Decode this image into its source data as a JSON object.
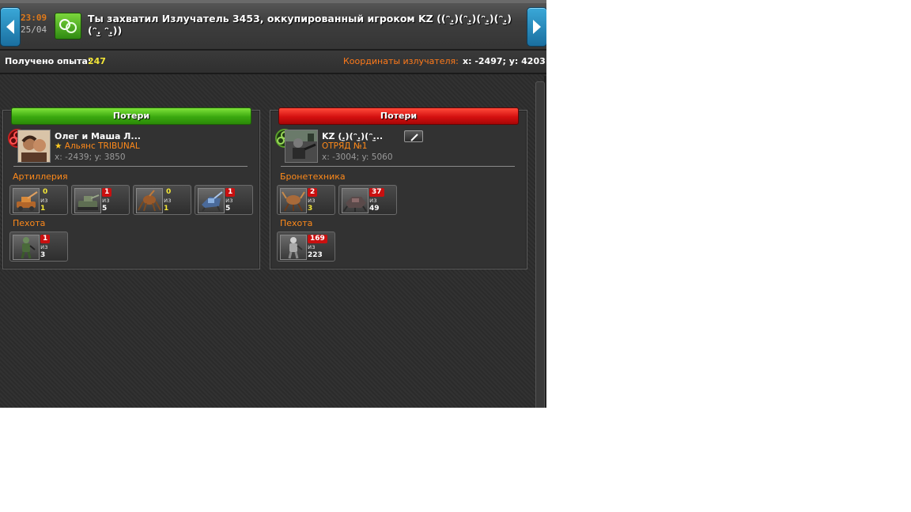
{
  "header": {
    "time": "23:09",
    "date": "25/04",
    "title": "Ты захватил Излучатель 3453, оккупированный игроком KZ ((ᵔ.̫)(ᵔ.̫)(ᵔ.̫)(ᵔ.̫)(ᵔ.̫ ᵔ.̫))",
    "icons": [
      "arrow-left-icon",
      "arrow-right-icon",
      "emitter-icon"
    ]
  },
  "info": {
    "xp_label": "Получено опыта:",
    "xp_value": "247",
    "coord_label": "Координаты излучателя:",
    "coord_value": "x: -2497; y: 4203"
  },
  "left": {
    "ribbon": "Потери",
    "player_name": "Олег и Маша Л...",
    "alliance": "Альянс TRIBUNAL",
    "coords": "x: -2439; y: 3850",
    "categories": [
      {
        "label": "Артиллерия",
        "units": [
          {
            "lost": "0",
            "of": "из",
            "total": "1",
            "icon": "artillery-icon"
          },
          {
            "lost": "1",
            "of": "из",
            "total": "5",
            "icon": "tank-icon"
          },
          {
            "lost": "0",
            "of": "из",
            "total": "1",
            "icon": "spider-mech-icon"
          },
          {
            "lost": "1",
            "of": "из",
            "total": "5",
            "icon": "blue-mech-icon"
          }
        ]
      },
      {
        "label": "Пехота",
        "units": [
          {
            "lost": "1",
            "of": "из",
            "total": "3",
            "icon": "soldier-icon"
          }
        ]
      }
    ]
  },
  "right": {
    "ribbon": "Потери",
    "player_name": "KZ (.̫)(ᵔ.̫)(ᵔ.̫..",
    "alliance": "ОТРЯД №1",
    "coords": "x: -3004; y: 5060",
    "categories": [
      {
        "label": "Бронетехника",
        "units": [
          {
            "lost": "2",
            "of": "из",
            "total": "3",
            "icon": "crab-mech-icon"
          },
          {
            "lost": "37",
            "of": "из",
            "total": "49",
            "icon": "crawler-icon"
          }
        ]
      },
      {
        "label": "Пехота",
        "units": [
          {
            "lost": "169",
            "of": "из",
            "total": "223",
            "icon": "soldier-icon"
          }
        ]
      }
    ]
  },
  "colors": {
    "accent_orange": "#ff8a1a",
    "xp_yellow": "#f3e637",
    "win_green": "#3aa80f",
    "loss_red": "#d41010"
  }
}
